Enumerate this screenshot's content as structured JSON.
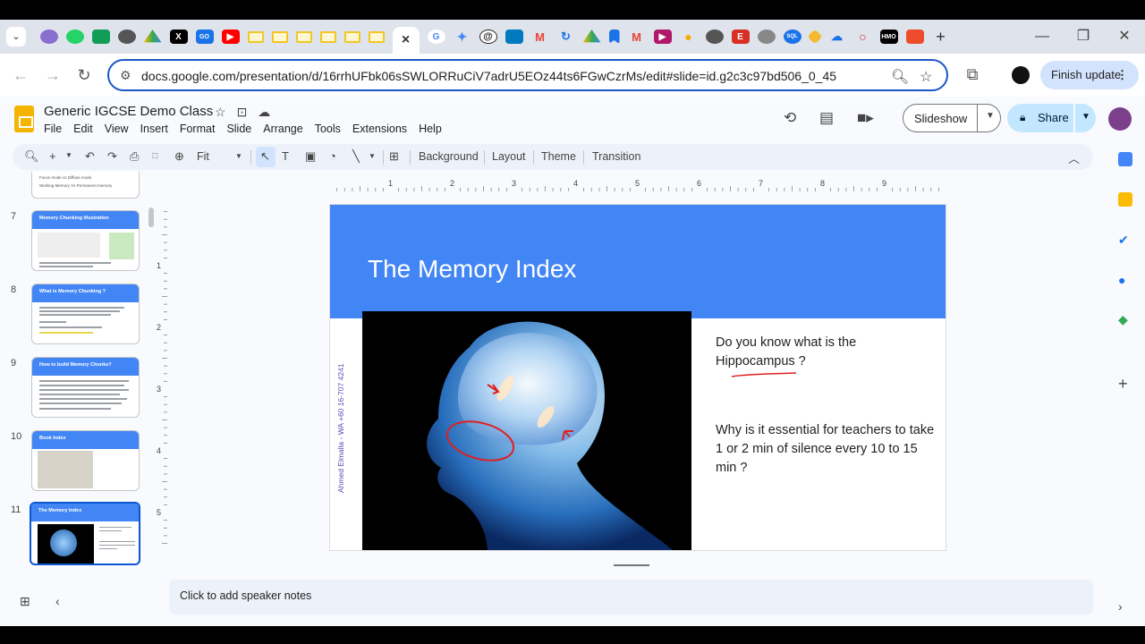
{
  "browser": {
    "active_tab_close": "×",
    "url": "docs.google.com/presentation/d/16rrhUFbk06sSWLORRuCiV7adrU5EOz44ts6FGwCzrMs/edit#slide=id.g2c3c97bd506_0_45",
    "finish_update_label": "Finish update",
    "new_tab_label": "+",
    "tab_icons": [
      "chromium",
      "whatsapp",
      "sheets",
      "chrome",
      "drive",
      "x",
      "gomeet",
      "youtube",
      "slides",
      "slides",
      "slides",
      "slides",
      "slides",
      "slides",
      "slides-active",
      "google",
      "gemini",
      "at",
      "trello",
      "gmail",
      "sync",
      "drive2",
      "bookmark",
      "gmail2",
      "pdf",
      "bulb",
      "web",
      "extension",
      "ring",
      "sql",
      "binance",
      "cloud",
      "opera",
      "hmo",
      "shop"
    ]
  },
  "doc": {
    "title": "Generic IGCSE Demo Class",
    "menu": [
      "File",
      "Edit",
      "View",
      "Insert",
      "Format",
      "Slide",
      "Arrange",
      "Tools",
      "Extensions",
      "Help"
    ],
    "slideshow_label": "Slideshow",
    "share_label": "Share"
  },
  "toolbar": {
    "zoom_label": "Fit",
    "background_label": "Background",
    "layout_label": "Layout",
    "theme_label": "Theme",
    "transition_label": "Transition"
  },
  "ruler": {
    "h_numbers": [
      "1",
      "2",
      "3",
      "4",
      "5",
      "6",
      "7",
      "8",
      "9"
    ],
    "v_numbers": [
      "1",
      "2",
      "3",
      "4",
      "5"
    ]
  },
  "filmstrip": {
    "top_partial_lines": [
      "Focus mode vs Diffuse mode",
      "Working Memory Vs Permanent memory"
    ],
    "thumbs": [
      {
        "num": "7",
        "title": "Memory Chunking illustration"
      },
      {
        "num": "8",
        "title": "What is Memory Chunking ?"
      },
      {
        "num": "9",
        "title": "How to build Memory Chunks?"
      },
      {
        "num": "10",
        "title": "Book Index"
      },
      {
        "num": "11",
        "title": "The Memory Index"
      }
    ]
  },
  "slide": {
    "title": "The Memory Index",
    "side_label": "Ahmed Elmalla - WA +60 16-707 4241",
    "question1": "Do you know what is the Hippocampus ?",
    "question2": "Why is it essential for teachers to take 1 or 2 min of silence every 10 to 15 min ?",
    "header_color": "#4285f4"
  },
  "notes": {
    "placeholder": "Click to add speaker notes"
  }
}
